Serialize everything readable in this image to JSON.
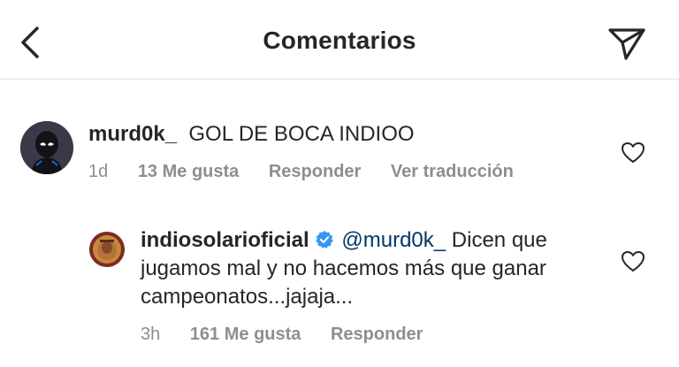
{
  "header": {
    "title": "Comentarios"
  },
  "comment": {
    "username": "murd0k_",
    "text": "GOL DE BOCA INDIOO",
    "time": "1d",
    "likes": "13 Me gusta",
    "reply": "Responder",
    "translate": "Ver traducción"
  },
  "reply": {
    "username": "indiosolarioficial",
    "mention": "@murd0k_",
    "text": "Dicen que jugamos mal y no hacemos más que ganar campeonatos...jajaja...",
    "time": "3h",
    "likes": "161 Me gusta",
    "reply": "Responder"
  },
  "colors": {
    "mention": "#00376b",
    "verified": "#3897f0",
    "meta": "#8e8e8e"
  }
}
